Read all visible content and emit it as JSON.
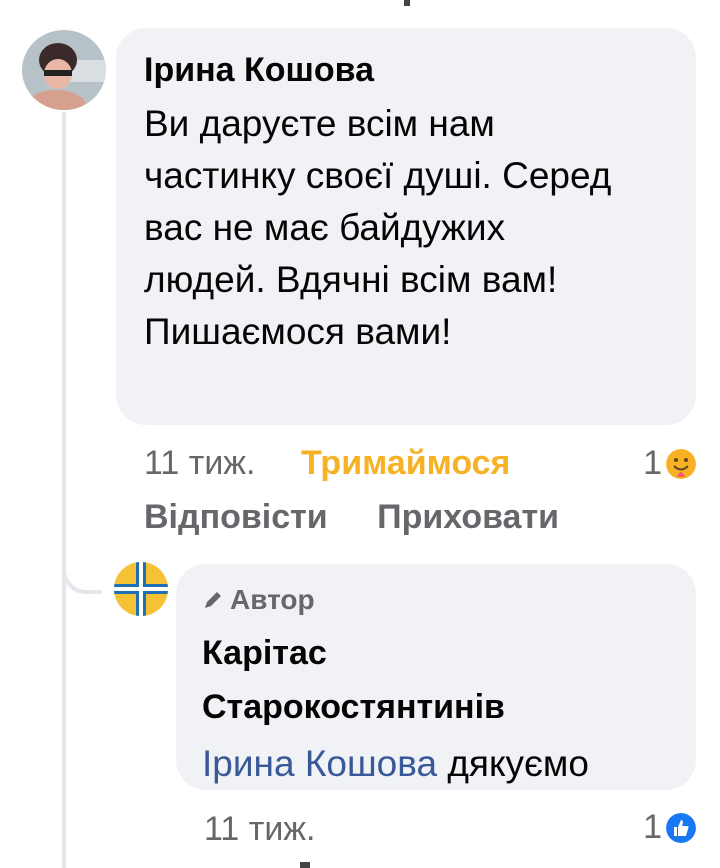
{
  "colors": {
    "bubble_bg": "#f0f2f5",
    "meta_text": "#65676b",
    "reaction_care": "#f7b125",
    "link_blue": "#385898",
    "like_blue": "#1877f2"
  },
  "comment": {
    "author": "Ірина Кошова",
    "text": "Ви даруєте всім нам частинку своєї душі. Серед вас не має байдужих людей.  Вдячні всім вам! Пишаємося вами!",
    "time": "11 тиж.",
    "user_reaction": "Тримаймося",
    "reaction_count": "1",
    "reaction_icon": "care-emoji-icon",
    "reply_label": "Відповісти",
    "hide_label": "Приховати"
  },
  "reply": {
    "badge": "Автор",
    "badge_icon": "pencil-icon",
    "author": "Карітас Старокостянтинів",
    "mention": "Ірина Кошова",
    "text": "дякуємо",
    "time": "11 тиж.",
    "reaction_count": "1",
    "reaction_icon": "like-thumb-icon"
  }
}
